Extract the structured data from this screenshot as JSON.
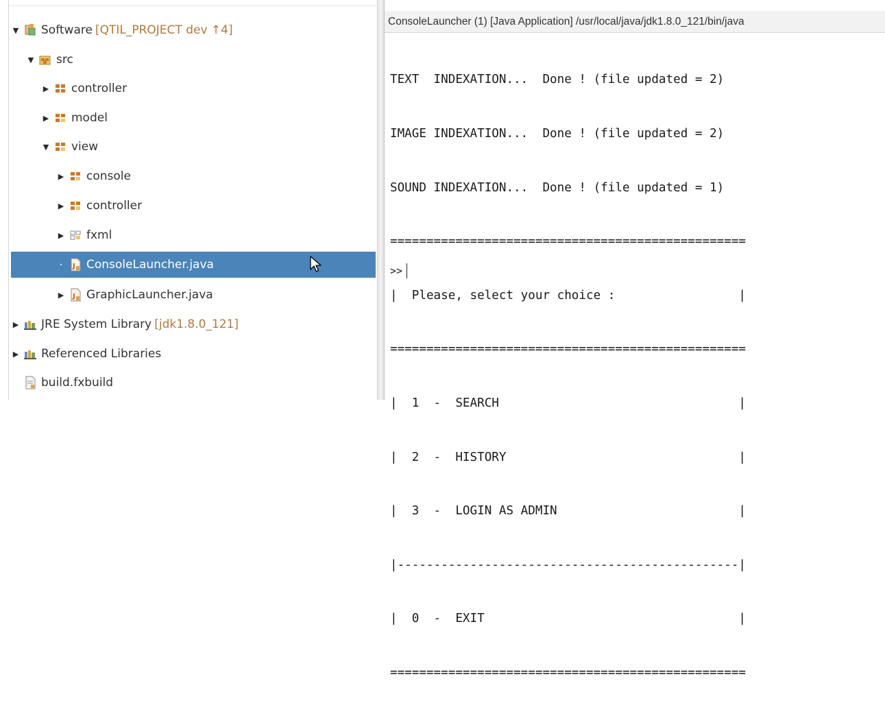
{
  "explorer": {
    "items": [
      {
        "label": "Software",
        "decoration": "[QTIL_PROJECT dev ↑4]",
        "icon": "project-icon",
        "expanded": true,
        "twisty": "expanded"
      },
      {
        "label": "src",
        "icon": "source-folder-icon",
        "twisty": "expanded"
      },
      {
        "label": "controller",
        "icon": "package-icon",
        "twisty": "collapsed"
      },
      {
        "label": "model",
        "icon": "package-icon",
        "twisty": "collapsed"
      },
      {
        "label": "view",
        "icon": "package-icon",
        "twisty": "expanded"
      },
      {
        "label": "console",
        "icon": "package-icon",
        "twisty": "collapsed"
      },
      {
        "label": "controller",
        "icon": "package-icon",
        "twisty": "collapsed"
      },
      {
        "label": "fxml",
        "icon": "empty-package-icon",
        "twisty": "collapsed"
      },
      {
        "label": "ConsoleLauncher.java",
        "icon": "java-file-icon",
        "twisty": "dot",
        "selected": true
      },
      {
        "label": "GraphicLauncher.java",
        "icon": "java-file-icon",
        "twisty": "collapsed"
      },
      {
        "label": "JRE System Library",
        "decoration": "[jdk1.8.0_121]",
        "icon": "library-icon",
        "twisty": "collapsed"
      },
      {
        "label": "Referenced Libraries",
        "icon": "library-icon",
        "twisty": "collapsed"
      },
      {
        "label": "build.fxbuild",
        "icon": "file-icon",
        "twisty": "none"
      }
    ]
  },
  "console": {
    "title": "ConsoleLauncher (1) [Java Application] /usr/local/java/jdk1.8.0_121/bin/java",
    "lines": [
      "TEXT  INDEXATION...  Done ! (file updated = 2)",
      "IMAGE INDEXATION...  Done ! (file updated = 2)",
      "SOUND INDEXATION...  Done ! (file updated = 1)",
      "=================================================",
      "|  Please, select your choice :                 |",
      "=================================================",
      "|  1  -  SEARCH                                 |",
      "|  2  -  HISTORY                                |",
      "|  3  -  LOGIN AS ADMIN                         |",
      "|-----------------------------------------------|",
      "|  0  -  EXIT                                   |",
      "================================================="
    ],
    "prompt": ">>"
  },
  "colors": {
    "selection": "#4a84b8",
    "decoration": "#b07a3f",
    "package": "#c87a2a"
  }
}
